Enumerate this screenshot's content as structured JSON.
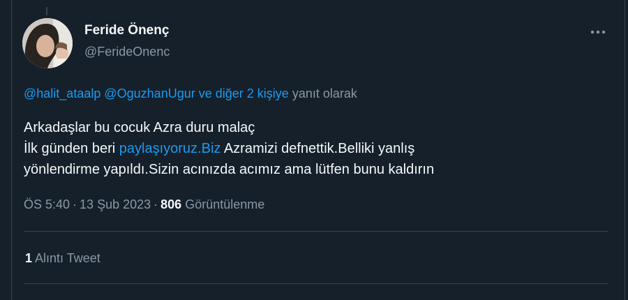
{
  "author": {
    "display_name": "Feride Önenç",
    "handle": "@FerideOnenc"
  },
  "more_icon": "more-horizontal-icon",
  "reply_context": {
    "mentions": [
      "@halit_ataalp",
      "@OguzhanUgur"
    ],
    "others_link": "ve diğer 2 kişiye",
    "suffix": "yanıt olarak"
  },
  "tweet": {
    "line1": "Arkadaşlar bu cocuk Azra duru malaç",
    "line2_prefix": "İlk günden beri",
    "line2_link": "paylaşıyoruz.Biz",
    "line2_suffix": "Azramizi defnettik.Belliki yanlış",
    "line3": "yönlendirme yapıldı.Sizin acınızda acımız ama lütfen bunu kaldırın"
  },
  "meta": {
    "time": "ÖS 5:40",
    "separator": "·",
    "date": "13 Şub 2023",
    "views_count": "806",
    "views_label": "Görüntülenme"
  },
  "stats": {
    "quote_count": "1",
    "quote_label": "Alıntı Tweet"
  },
  "colors": {
    "background": "#15202b",
    "link": "#1d9bf0",
    "secondary_text": "#8b98a5",
    "border": "#38444d"
  }
}
